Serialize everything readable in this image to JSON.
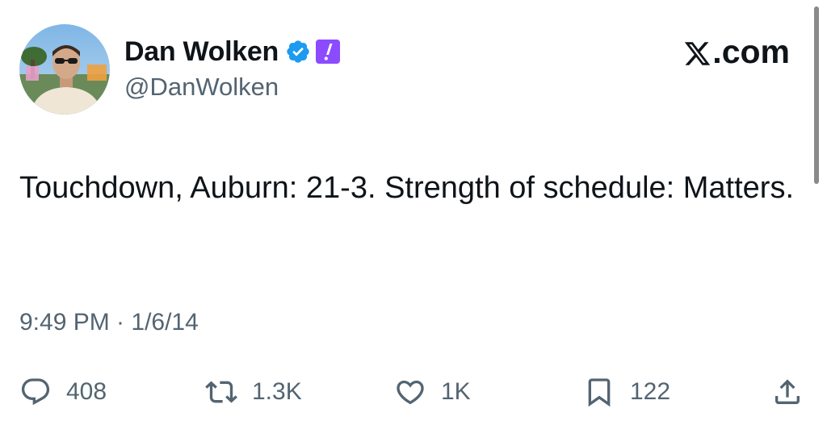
{
  "author": {
    "display_name": "Dan Wolken",
    "handle": "@DanWolken",
    "verified_icon": "verified-badge-icon",
    "affiliate_icon": "exclamation-badge-icon"
  },
  "brand": {
    "logo_icon": "x-logo-icon",
    "suffix": ".com"
  },
  "tweet": {
    "text": "Touchdown, Auburn: 21-3. Strength of schedule: Matters.",
    "timestamp": "9:49 PM · 1/6/14"
  },
  "actions": {
    "reply": {
      "icon": "reply-icon",
      "count": "408"
    },
    "retweet": {
      "icon": "retweet-icon",
      "count": "1.3K"
    },
    "like": {
      "icon": "heart-icon",
      "count": "1K"
    },
    "bookmark": {
      "icon": "bookmark-icon",
      "count": "122"
    },
    "share": {
      "icon": "share-icon"
    }
  },
  "colors": {
    "text_primary": "#0f1419",
    "text_secondary": "#536471",
    "verified_blue": "#1d9bf0",
    "affiliate_purple": "#8c4bff"
  }
}
